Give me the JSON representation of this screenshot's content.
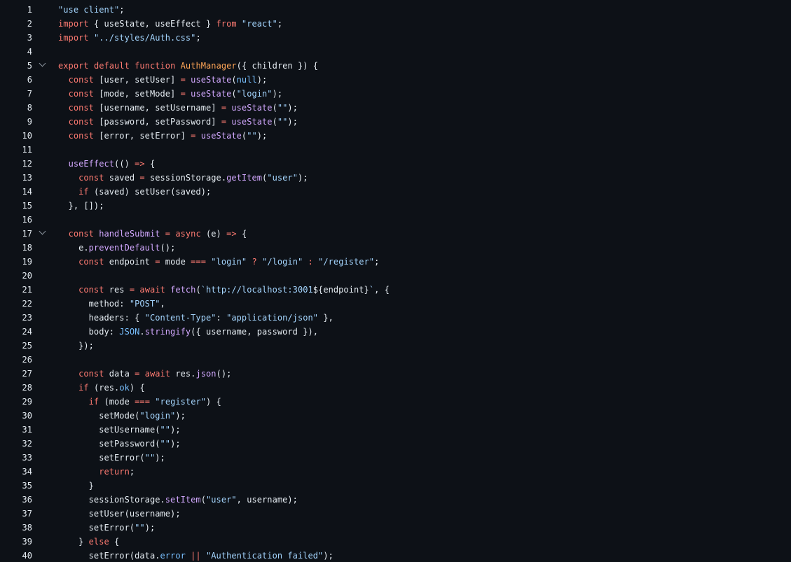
{
  "editor": {
    "language": "javascript",
    "colors": {
      "background": "#0d1117",
      "line_number": "#e6edf3",
      "plain": "#e6edf3",
      "keyword": "#ff7b72",
      "string": "#a5d6ff",
      "function": "#d2a8ff",
      "constant": "#79c0ff",
      "entity": "#ffa657",
      "fold_icon": "#8b949e"
    },
    "lines": [
      {
        "number": "1",
        "fold": false,
        "tokens": [
          {
            "t": "s",
            "v": "\"use client\""
          },
          {
            "t": "p",
            "v": ";"
          }
        ]
      },
      {
        "number": "2",
        "fold": false,
        "tokens": [
          {
            "t": "k",
            "v": "import"
          },
          {
            "t": "p",
            "v": " { useState, useEffect } "
          },
          {
            "t": "k",
            "v": "from"
          },
          {
            "t": "p",
            "v": " "
          },
          {
            "t": "s",
            "v": "\"react\""
          },
          {
            "t": "p",
            "v": ";"
          }
        ]
      },
      {
        "number": "3",
        "fold": false,
        "tokens": [
          {
            "t": "k",
            "v": "import"
          },
          {
            "t": "p",
            "v": " "
          },
          {
            "t": "s",
            "v": "\"../styles/Auth.css\""
          },
          {
            "t": "p",
            "v": ";"
          }
        ]
      },
      {
        "number": "4",
        "fold": false,
        "tokens": []
      },
      {
        "number": "5",
        "fold": true,
        "tokens": [
          {
            "t": "k",
            "v": "export"
          },
          {
            "t": "p",
            "v": " "
          },
          {
            "t": "k",
            "v": "default"
          },
          {
            "t": "p",
            "v": " "
          },
          {
            "t": "k",
            "v": "function"
          },
          {
            "t": "p",
            "v": " "
          },
          {
            "t": "o",
            "v": "AuthManager"
          },
          {
            "t": "p",
            "v": "({ children }) {"
          }
        ]
      },
      {
        "number": "6",
        "fold": false,
        "tokens": [
          {
            "t": "p",
            "v": "  "
          },
          {
            "t": "k",
            "v": "const"
          },
          {
            "t": "p",
            "v": " [user, setUser] "
          },
          {
            "t": "k",
            "v": "="
          },
          {
            "t": "p",
            "v": " "
          },
          {
            "t": "f",
            "v": "useState"
          },
          {
            "t": "p",
            "v": "("
          },
          {
            "t": "c",
            "v": "null"
          },
          {
            "t": "p",
            "v": ");"
          }
        ]
      },
      {
        "number": "7",
        "fold": false,
        "tokens": [
          {
            "t": "p",
            "v": "  "
          },
          {
            "t": "k",
            "v": "const"
          },
          {
            "t": "p",
            "v": " [mode, setMode] "
          },
          {
            "t": "k",
            "v": "="
          },
          {
            "t": "p",
            "v": " "
          },
          {
            "t": "f",
            "v": "useState"
          },
          {
            "t": "p",
            "v": "("
          },
          {
            "t": "s",
            "v": "\"login\""
          },
          {
            "t": "p",
            "v": ");"
          }
        ]
      },
      {
        "number": "8",
        "fold": false,
        "tokens": [
          {
            "t": "p",
            "v": "  "
          },
          {
            "t": "k",
            "v": "const"
          },
          {
            "t": "p",
            "v": " [username, setUsername] "
          },
          {
            "t": "k",
            "v": "="
          },
          {
            "t": "p",
            "v": " "
          },
          {
            "t": "f",
            "v": "useState"
          },
          {
            "t": "p",
            "v": "("
          },
          {
            "t": "s",
            "v": "\"\""
          },
          {
            "t": "p",
            "v": ");"
          }
        ]
      },
      {
        "number": "9",
        "fold": false,
        "tokens": [
          {
            "t": "p",
            "v": "  "
          },
          {
            "t": "k",
            "v": "const"
          },
          {
            "t": "p",
            "v": " [password, setPassword] "
          },
          {
            "t": "k",
            "v": "="
          },
          {
            "t": "p",
            "v": " "
          },
          {
            "t": "f",
            "v": "useState"
          },
          {
            "t": "p",
            "v": "("
          },
          {
            "t": "s",
            "v": "\"\""
          },
          {
            "t": "p",
            "v": ");"
          }
        ]
      },
      {
        "number": "10",
        "fold": false,
        "tokens": [
          {
            "t": "p",
            "v": "  "
          },
          {
            "t": "k",
            "v": "const"
          },
          {
            "t": "p",
            "v": " [error, setError] "
          },
          {
            "t": "k",
            "v": "="
          },
          {
            "t": "p",
            "v": " "
          },
          {
            "t": "f",
            "v": "useState"
          },
          {
            "t": "p",
            "v": "("
          },
          {
            "t": "s",
            "v": "\"\""
          },
          {
            "t": "p",
            "v": ");"
          }
        ]
      },
      {
        "number": "11",
        "fold": false,
        "tokens": []
      },
      {
        "number": "12",
        "fold": false,
        "tokens": [
          {
            "t": "p",
            "v": "  "
          },
          {
            "t": "f",
            "v": "useEffect"
          },
          {
            "t": "p",
            "v": "(() "
          },
          {
            "t": "k",
            "v": "=>"
          },
          {
            "t": "p",
            "v": " {"
          }
        ]
      },
      {
        "number": "13",
        "fold": false,
        "tokens": [
          {
            "t": "p",
            "v": "    "
          },
          {
            "t": "k",
            "v": "const"
          },
          {
            "t": "p",
            "v": " saved "
          },
          {
            "t": "k",
            "v": "="
          },
          {
            "t": "p",
            "v": " sessionStorage."
          },
          {
            "t": "f",
            "v": "getItem"
          },
          {
            "t": "p",
            "v": "("
          },
          {
            "t": "s",
            "v": "\"user\""
          },
          {
            "t": "p",
            "v": ");"
          }
        ]
      },
      {
        "number": "14",
        "fold": false,
        "tokens": [
          {
            "t": "p",
            "v": "    "
          },
          {
            "t": "k",
            "v": "if"
          },
          {
            "t": "p",
            "v": " (saved) setUser(saved);"
          }
        ]
      },
      {
        "number": "15",
        "fold": false,
        "tokens": [
          {
            "t": "p",
            "v": "  }, []);"
          }
        ]
      },
      {
        "number": "16",
        "fold": false,
        "tokens": []
      },
      {
        "number": "17",
        "fold": true,
        "tokens": [
          {
            "t": "p",
            "v": "  "
          },
          {
            "t": "k",
            "v": "const"
          },
          {
            "t": "p",
            "v": " "
          },
          {
            "t": "f",
            "v": "handleSubmit"
          },
          {
            "t": "p",
            "v": " "
          },
          {
            "t": "k",
            "v": "="
          },
          {
            "t": "p",
            "v": " "
          },
          {
            "t": "k",
            "v": "async"
          },
          {
            "t": "p",
            "v": " (e) "
          },
          {
            "t": "k",
            "v": "=>"
          },
          {
            "t": "p",
            "v": " {"
          }
        ]
      },
      {
        "number": "18",
        "fold": false,
        "tokens": [
          {
            "t": "p",
            "v": "    e."
          },
          {
            "t": "f",
            "v": "preventDefault"
          },
          {
            "t": "p",
            "v": "();"
          }
        ]
      },
      {
        "number": "19",
        "fold": false,
        "tokens": [
          {
            "t": "p",
            "v": "    "
          },
          {
            "t": "k",
            "v": "const"
          },
          {
            "t": "p",
            "v": " endpoint "
          },
          {
            "t": "k",
            "v": "="
          },
          {
            "t": "p",
            "v": " mode "
          },
          {
            "t": "k",
            "v": "==="
          },
          {
            "t": "p",
            "v": " "
          },
          {
            "t": "s",
            "v": "\"login\""
          },
          {
            "t": "p",
            "v": " "
          },
          {
            "t": "k",
            "v": "?"
          },
          {
            "t": "p",
            "v": " "
          },
          {
            "t": "s",
            "v": "\"/login\""
          },
          {
            "t": "p",
            "v": " "
          },
          {
            "t": "k",
            "v": ":"
          },
          {
            "t": "p",
            "v": " "
          },
          {
            "t": "s",
            "v": "\"/register\""
          },
          {
            "t": "p",
            "v": ";"
          }
        ]
      },
      {
        "number": "20",
        "fold": false,
        "tokens": []
      },
      {
        "number": "21",
        "fold": false,
        "tokens": [
          {
            "t": "p",
            "v": "    "
          },
          {
            "t": "k",
            "v": "const"
          },
          {
            "t": "p",
            "v": " res "
          },
          {
            "t": "k",
            "v": "="
          },
          {
            "t": "p",
            "v": " "
          },
          {
            "t": "k",
            "v": "await"
          },
          {
            "t": "p",
            "v": " "
          },
          {
            "t": "f",
            "v": "fetch"
          },
          {
            "t": "p",
            "v": "("
          },
          {
            "t": "s",
            "v": "`http://localhost:3001"
          },
          {
            "t": "p",
            "v": "${endpoint}"
          },
          {
            "t": "s",
            "v": "`"
          },
          {
            "t": "p",
            "v": ", {"
          }
        ]
      },
      {
        "number": "22",
        "fold": false,
        "tokens": [
          {
            "t": "p",
            "v": "      method: "
          },
          {
            "t": "s",
            "v": "\"POST\""
          },
          {
            "t": "p",
            "v": ","
          }
        ]
      },
      {
        "number": "23",
        "fold": false,
        "tokens": [
          {
            "t": "p",
            "v": "      headers: { "
          },
          {
            "t": "s",
            "v": "\"Content-Type\""
          },
          {
            "t": "p",
            "v": ": "
          },
          {
            "t": "s",
            "v": "\"application/json\""
          },
          {
            "t": "p",
            "v": " },"
          }
        ]
      },
      {
        "number": "24",
        "fold": false,
        "tokens": [
          {
            "t": "p",
            "v": "      body: "
          },
          {
            "t": "c",
            "v": "JSON"
          },
          {
            "t": "p",
            "v": "."
          },
          {
            "t": "f",
            "v": "stringify"
          },
          {
            "t": "p",
            "v": "({ username, password }),"
          }
        ]
      },
      {
        "number": "25",
        "fold": false,
        "tokens": [
          {
            "t": "p",
            "v": "    });"
          }
        ]
      },
      {
        "number": "26",
        "fold": false,
        "tokens": []
      },
      {
        "number": "27",
        "fold": false,
        "tokens": [
          {
            "t": "p",
            "v": "    "
          },
          {
            "t": "k",
            "v": "const"
          },
          {
            "t": "p",
            "v": " data "
          },
          {
            "t": "k",
            "v": "="
          },
          {
            "t": "p",
            "v": " "
          },
          {
            "t": "k",
            "v": "await"
          },
          {
            "t": "p",
            "v": " res."
          },
          {
            "t": "f",
            "v": "json"
          },
          {
            "t": "p",
            "v": "();"
          }
        ]
      },
      {
        "number": "28",
        "fold": false,
        "tokens": [
          {
            "t": "p",
            "v": "    "
          },
          {
            "t": "k",
            "v": "if"
          },
          {
            "t": "p",
            "v": " (res."
          },
          {
            "t": "c",
            "v": "ok"
          },
          {
            "t": "p",
            "v": ") {"
          }
        ]
      },
      {
        "number": "29",
        "fold": false,
        "tokens": [
          {
            "t": "p",
            "v": "      "
          },
          {
            "t": "k",
            "v": "if"
          },
          {
            "t": "p",
            "v": " (mode "
          },
          {
            "t": "k",
            "v": "==="
          },
          {
            "t": "p",
            "v": " "
          },
          {
            "t": "s",
            "v": "\"register\""
          },
          {
            "t": "p",
            "v": ") {"
          }
        ]
      },
      {
        "number": "30",
        "fold": false,
        "tokens": [
          {
            "t": "p",
            "v": "        setMode("
          },
          {
            "t": "s",
            "v": "\"login\""
          },
          {
            "t": "p",
            "v": ");"
          }
        ]
      },
      {
        "number": "31",
        "fold": false,
        "tokens": [
          {
            "t": "p",
            "v": "        setUsername("
          },
          {
            "t": "s",
            "v": "\"\""
          },
          {
            "t": "p",
            "v": ");"
          }
        ]
      },
      {
        "number": "32",
        "fold": false,
        "tokens": [
          {
            "t": "p",
            "v": "        setPassword("
          },
          {
            "t": "s",
            "v": "\"\""
          },
          {
            "t": "p",
            "v": ");"
          }
        ]
      },
      {
        "number": "33",
        "fold": false,
        "tokens": [
          {
            "t": "p",
            "v": "        setError("
          },
          {
            "t": "s",
            "v": "\"\""
          },
          {
            "t": "p",
            "v": ");"
          }
        ]
      },
      {
        "number": "34",
        "fold": false,
        "tokens": [
          {
            "t": "p",
            "v": "        "
          },
          {
            "t": "k",
            "v": "return"
          },
          {
            "t": "p",
            "v": ";"
          }
        ]
      },
      {
        "number": "35",
        "fold": false,
        "tokens": [
          {
            "t": "p",
            "v": "      }"
          }
        ]
      },
      {
        "number": "36",
        "fold": false,
        "tokens": [
          {
            "t": "p",
            "v": "      sessionStorage."
          },
          {
            "t": "f",
            "v": "setItem"
          },
          {
            "t": "p",
            "v": "("
          },
          {
            "t": "s",
            "v": "\"user\""
          },
          {
            "t": "p",
            "v": ", username);"
          }
        ]
      },
      {
        "number": "37",
        "fold": false,
        "tokens": [
          {
            "t": "p",
            "v": "      setUser(username);"
          }
        ]
      },
      {
        "number": "38",
        "fold": false,
        "tokens": [
          {
            "t": "p",
            "v": "      setError("
          },
          {
            "t": "s",
            "v": "\"\""
          },
          {
            "t": "p",
            "v": ");"
          }
        ]
      },
      {
        "number": "39",
        "fold": false,
        "tokens": [
          {
            "t": "p",
            "v": "    } "
          },
          {
            "t": "k",
            "v": "else"
          },
          {
            "t": "p",
            "v": " {"
          }
        ]
      },
      {
        "number": "40",
        "fold": false,
        "tokens": [
          {
            "t": "p",
            "v": "      setError(data."
          },
          {
            "t": "c",
            "v": "error"
          },
          {
            "t": "p",
            "v": " "
          },
          {
            "t": "k",
            "v": "||"
          },
          {
            "t": "p",
            "v": " "
          },
          {
            "t": "s",
            "v": "\"Authentication failed\""
          },
          {
            "t": "p",
            "v": ");"
          }
        ]
      }
    ]
  }
}
